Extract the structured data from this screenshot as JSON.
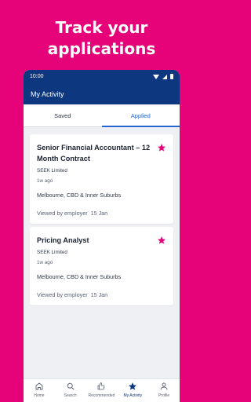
{
  "headline": {
    "line1": "Track your",
    "line2": "applications"
  },
  "statusbar": {
    "time": "10:00"
  },
  "appbar": {
    "title": "My Activity"
  },
  "tabs": [
    {
      "label": "Saved",
      "active": false
    },
    {
      "label": "Applied",
      "active": true
    }
  ],
  "jobs": [
    {
      "title": "Senior Financial Accountant – 12 Month Contract",
      "company": "SEEK Limited",
      "age": "1w ago",
      "location": "Melbourne, CBD & Inner Suburbs",
      "viewed_label": "Viewed by employer",
      "viewed_date": "15 Jan",
      "icon": "star-icon"
    },
    {
      "title": "Pricing Analyst",
      "company": "SEEK Limited",
      "age": "1w ago",
      "location": "Melbourne, CBD & Inner Suburbs",
      "viewed_label": "Viewed by employer",
      "viewed_date": "15 Jan",
      "icon": "star-icon"
    }
  ],
  "nav": [
    {
      "label": "Home",
      "icon": "home-icon"
    },
    {
      "label": "Search",
      "icon": "search-icon"
    },
    {
      "label": "Recommended",
      "icon": "thumbs-up-icon"
    },
    {
      "label": "My Activity",
      "icon": "star-icon",
      "active": true
    },
    {
      "label": "Profile",
      "icon": "profile-icon"
    }
  ],
  "colors": {
    "brand_pink": "#e60278",
    "brand_navy": "#0d3880",
    "accent_blue": "#2765cf"
  }
}
